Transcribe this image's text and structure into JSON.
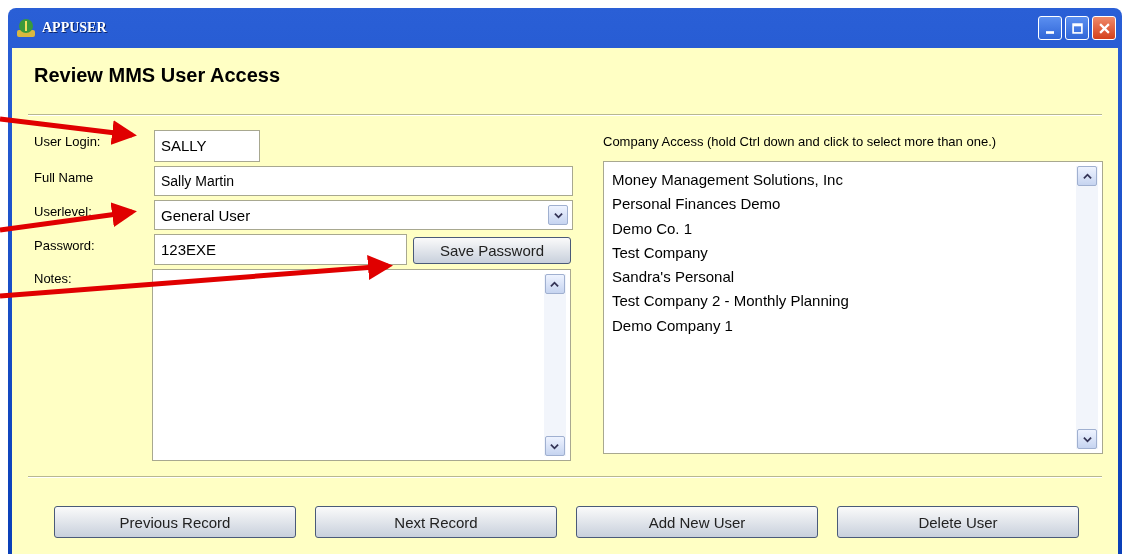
{
  "window": {
    "title": "APPUSER"
  },
  "heading": "Review MMS User Access",
  "form": {
    "login_label": "User Login:",
    "login": "SALLY",
    "fullname_label": "Full Name",
    "fullname": "Sally Martin",
    "userlevel_label": "Userlevel:",
    "userlevel": "General User",
    "password_label": "Password:",
    "password": "123EXE",
    "save_button": "Save Password",
    "notes_label": "Notes:"
  },
  "company_access": {
    "label": "Company Access (hold Ctrl down and click to select more than one.)",
    "items": [
      {
        "name": "Money Management Solutions, Inc",
        "selected": false
      },
      {
        "name": "Personal Finances Demo",
        "selected": false
      },
      {
        "name": "Demo Co. 1",
        "selected": false
      },
      {
        "name": "Test Company",
        "selected": false
      },
      {
        "name": "Sandra's Personal",
        "selected": false
      },
      {
        "name": "Test Company 2 - Monthly Planning",
        "selected": false
      },
      {
        "name": "Demo Company 1",
        "selected": false
      }
    ]
  },
  "buttons": [
    "Previous Record",
    "Next Record",
    "Add New User",
    "Delete User"
  ]
}
